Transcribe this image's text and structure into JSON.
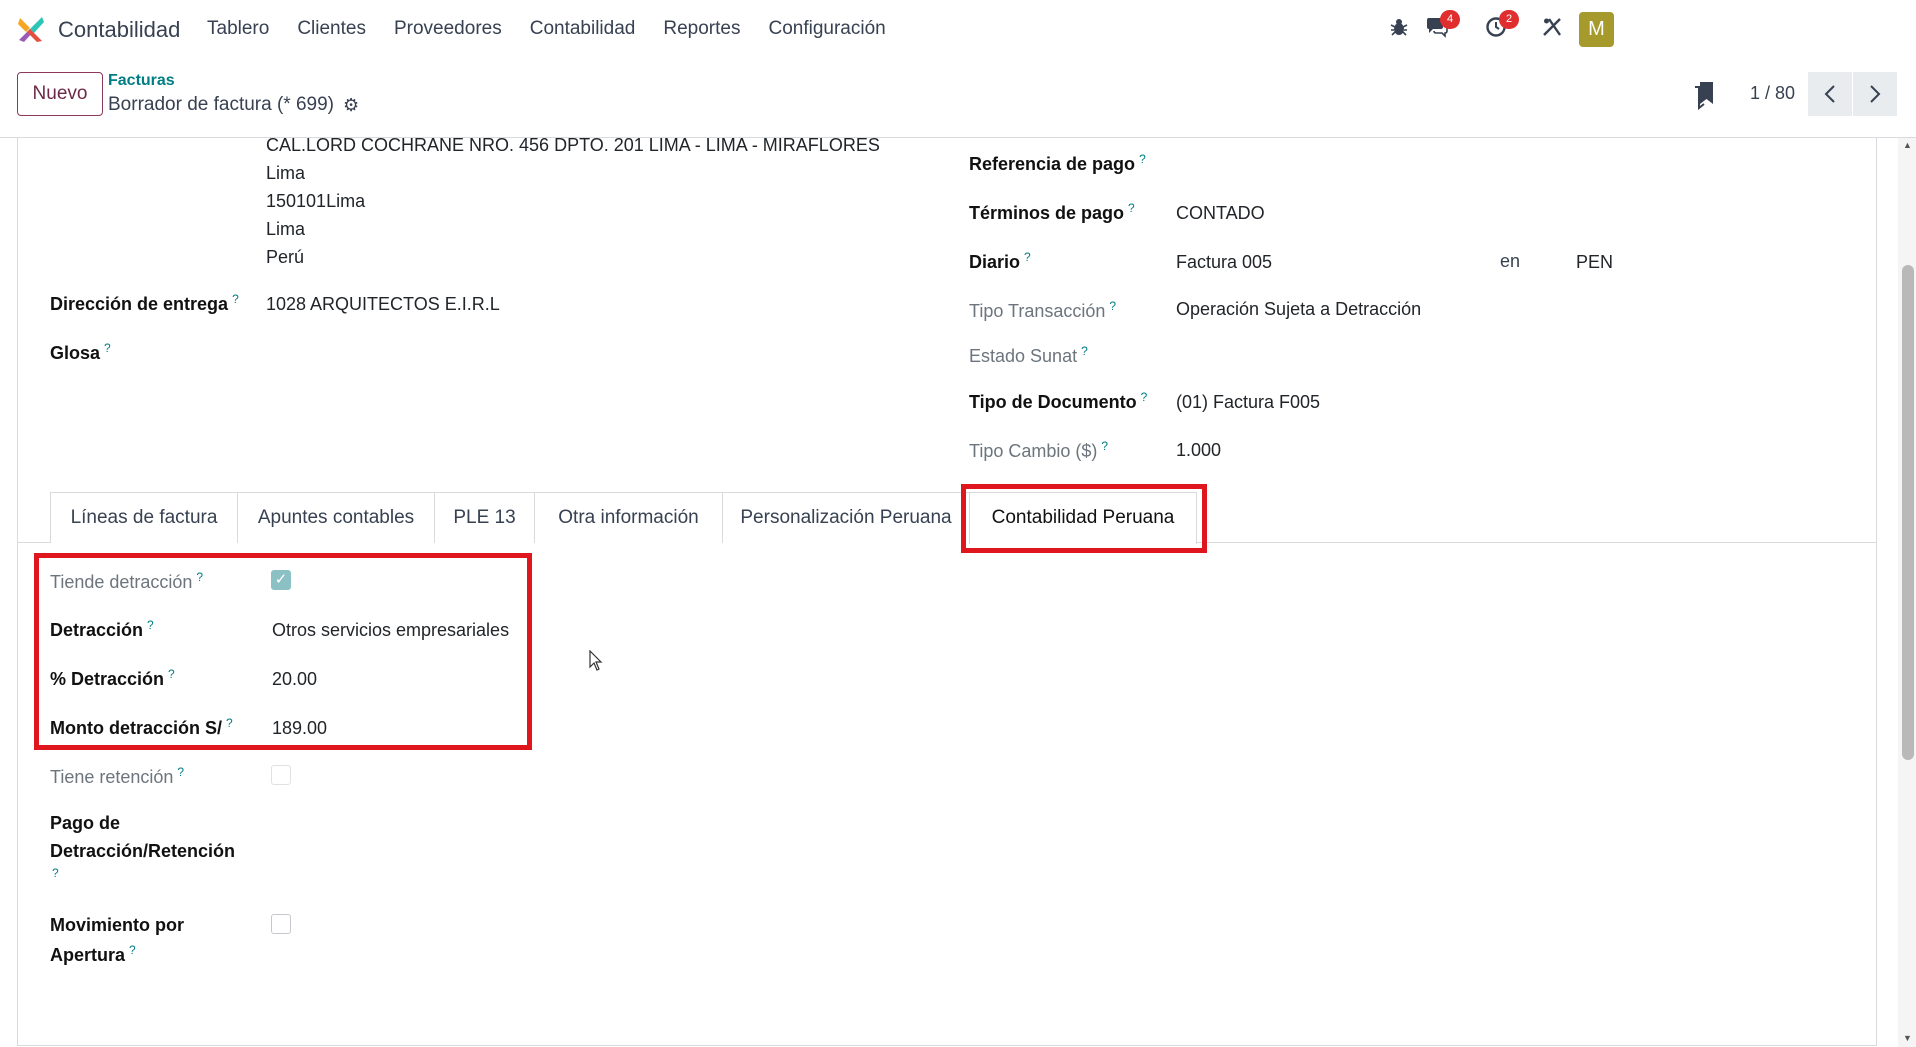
{
  "navbar": {
    "app_name": "Contabilidad",
    "menu": [
      "Tablero",
      "Clientes",
      "Proveedores",
      "Contabilidad",
      "Reportes",
      "Configuración"
    ],
    "messages_badge": "4",
    "activities_badge": "2",
    "avatar_letter": "M",
    "avatar_color": "#a59a2b"
  },
  "control": {
    "new_button": "Nuevo",
    "breadcrumb": "Facturas",
    "record_title": "Borrador de factura (* 699)",
    "pager": "1 / 80"
  },
  "partner_address": {
    "line1": "CAL.LORD COCHRANE NRO. 456 DPTO. 201 LIMA - LIMA - MIRAFLORES",
    "line2": "Lima",
    "line3": "150101Lima",
    "line4": "Lima",
    "line5": "Perú"
  },
  "left_fields": {
    "delivery_label": "Dirección de entrega",
    "delivery_value": "1028 ARQUITECTOS E.I.R.L",
    "glosa_label": "Glosa"
  },
  "right_fields": {
    "payment_ref_label": "Referencia de pago",
    "payment_terms_label": "Términos de pago",
    "payment_terms_value": "CONTADO",
    "journal_label": "Diario",
    "journal_value": "Factura 005",
    "currency_connector": "en",
    "currency_value": "PEN",
    "transaction_type_label": "Tipo Transacción",
    "transaction_type_value": "Operación Sujeta a Detracción",
    "sunat_state_label": "Estado Sunat",
    "doc_type_label": "Tipo de Documento",
    "doc_type_value": "(01) Factura F005",
    "exchange_rate_label": "Tipo Cambio ($)",
    "exchange_rate_value": "1.000"
  },
  "tabs": [
    "Líneas de factura",
    "Apuntes contables",
    "PLE 13",
    "Otra información",
    "Personalización Peruana",
    "Contabilidad Peruana"
  ],
  "peru_tab": {
    "has_detraction_label": "Tiende detracción",
    "has_detraction_checked": true,
    "detraction_label": "Detracción",
    "detraction_value": "Otros servicios empresariales",
    "detraction_pct_label": "% Detracción",
    "detraction_pct_value": "20.00",
    "detraction_amount_label": "Monto detracción S/",
    "detraction_amount_value": "189.00",
    "has_retention_label": "Tiene retención",
    "has_retention_checked": false,
    "payment_label_line1": "Pago de",
    "payment_label_line2": "Detracción/Retención",
    "opening_label_line1": "Movimiento por",
    "opening_label_line2": "Apertura",
    "opening_checked": false
  },
  "colors": {
    "highlight": "#e0161e",
    "accent": "#017e84",
    "primary": "#6d2a47",
    "checkbox_checked": "#8bc1c4"
  }
}
